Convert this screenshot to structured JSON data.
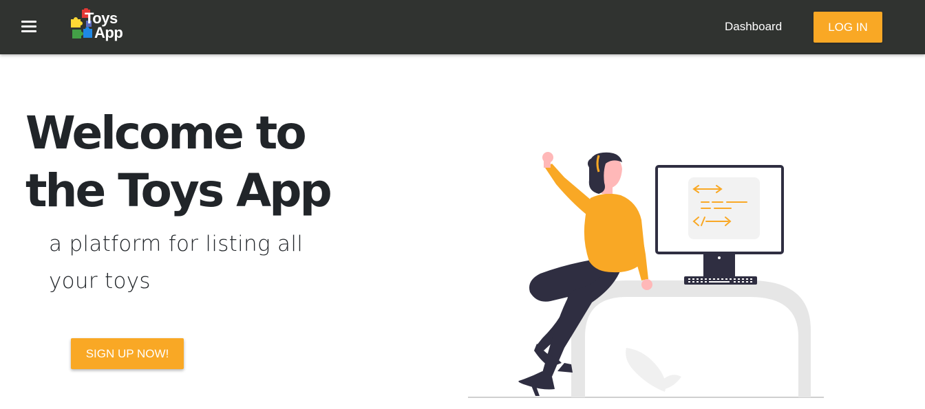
{
  "navbar": {
    "menu_icon": "hamburger-menu-icon",
    "logo": {
      "line1": "Toys",
      "line2": "App",
      "icon": "puzzle-pieces-icon"
    },
    "links": [
      {
        "label": "Dashboard"
      }
    ],
    "login_label": "LOG IN"
  },
  "hero": {
    "title": "Welcome to the Toys App",
    "subtitle": "a platform for listing all your toys",
    "signup_label": "SIGN UP NOW!",
    "illustration": "woman-cheering-at-computer-illustration"
  },
  "colors": {
    "navbar_bg": "#303330",
    "accent": "#f9a825",
    "text_dark": "#212529",
    "illustration_dark": "#2f2e41",
    "illustration_light": "#e6e6e6"
  }
}
